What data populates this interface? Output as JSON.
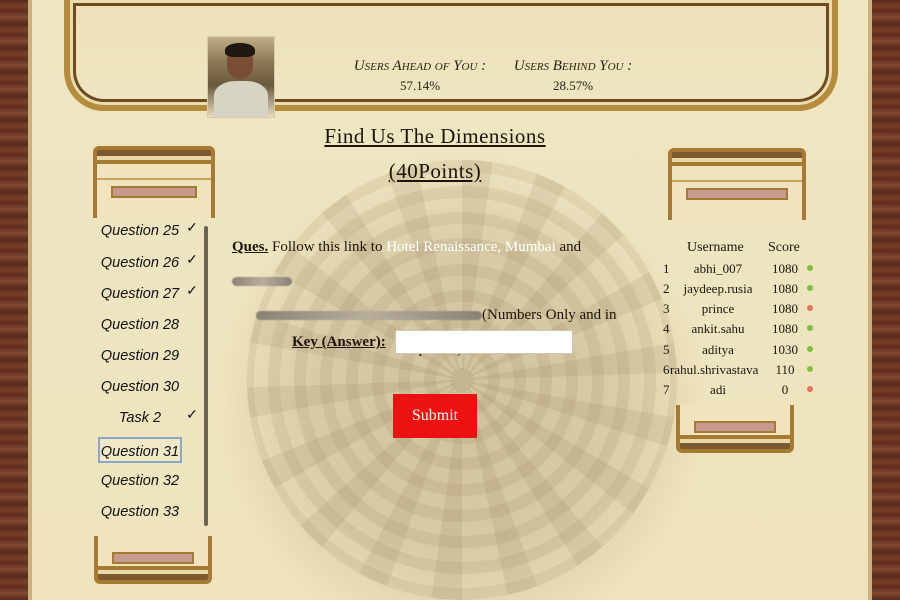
{
  "stats": {
    "ahead_label": "Users Ahead of You :",
    "ahead_value": "57.14%",
    "behind_label": "Users Behind You :",
    "behind_value": "28.57%"
  },
  "question": {
    "title_line1": "Find Us The Dimensions",
    "title_line2": "(40Points)",
    "ques_label": "Ques.",
    "text_1": "Follow this link to",
    "link_text": "Hotel Renaissance, Mumbai",
    "text_2": "and",
    "text_3": "(Numbers Only and in",
    "text_4": "sequence)",
    "key_label": "Key (Answer):",
    "key_value": "",
    "submit_label": "Submit"
  },
  "sidebar": {
    "items": [
      {
        "label": "Question 25",
        "done": true,
        "active": false
      },
      {
        "label": "Question 26",
        "done": true,
        "active": false
      },
      {
        "label": "Question 27",
        "done": true,
        "active": false
      },
      {
        "label": "Question 28",
        "done": false,
        "active": false
      },
      {
        "label": "Question 29",
        "done": false,
        "active": false
      },
      {
        "label": "Question 30",
        "done": false,
        "active": false
      },
      {
        "label": "Task 2",
        "done": true,
        "active": false
      },
      {
        "label": "Question 31",
        "done": false,
        "active": true
      },
      {
        "label": "Question 32",
        "done": false,
        "active": false
      },
      {
        "label": "Question 33",
        "done": false,
        "active": false
      }
    ],
    "check_glyph": "✓"
  },
  "leaderboard": {
    "headers": {
      "username": "Username",
      "score": "Score"
    },
    "rows": [
      {
        "rank": "1",
        "username": "abhi_007",
        "score": "1080",
        "status_color": "#7fbf3f"
      },
      {
        "rank": "2",
        "username": "jaydeep.rusia",
        "score": "1080",
        "status_color": "#7fbf3f"
      },
      {
        "rank": "3",
        "username": "prince",
        "score": "1080",
        "status_color": "#e5735f"
      },
      {
        "rank": "4",
        "username": "ankit.sahu",
        "score": "1080",
        "status_color": "#7fbf3f"
      },
      {
        "rank": "5",
        "username": "aditya",
        "score": "1030",
        "status_color": "#7fbf3f"
      },
      {
        "rank": "6",
        "username": "rahul.shrivastava",
        "score": "110",
        "status_color": "#7fbf3f"
      },
      {
        "rank": "7",
        "username": "adi",
        "score": "0",
        "status_color": "#e5735f"
      }
    ]
  }
}
